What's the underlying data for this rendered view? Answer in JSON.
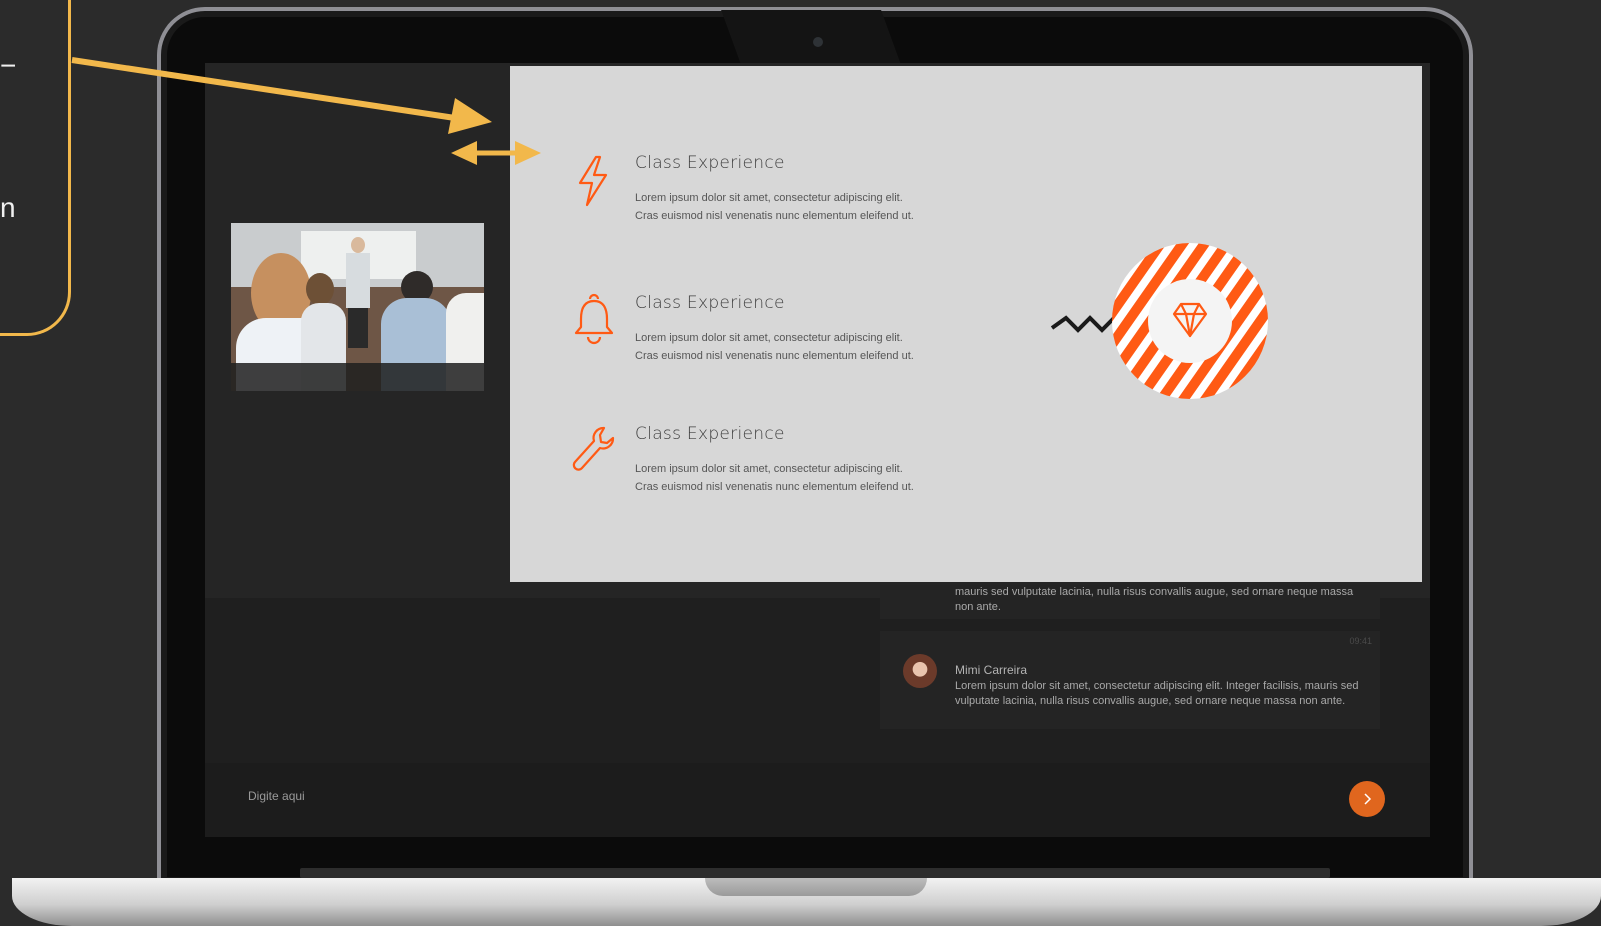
{
  "callout": {
    "glyphs": [
      "−",
      "n"
    ]
  },
  "features": [
    {
      "icon": "lightning-icon",
      "title": "Class Experience",
      "description": "Lorem ipsum dolor sit amet, consectetur adipiscing elit. Cras euismod nisl venenatis nunc elementum eleifend ut."
    },
    {
      "icon": "bell-icon",
      "title": "Class Experience",
      "description": "Lorem ipsum dolor sit amet, consectetur adipiscing elit. Cras euismod nisl venenatis nunc elementum eleifend ut."
    },
    {
      "icon": "wrench-icon",
      "title": "Class Experience",
      "description": "Lorem ipsum dolor sit amet, consectetur adipiscing elit. Cras euismod nisl venenatis nunc elementum eleifend ut."
    }
  ],
  "badge": {
    "icon": "diamond-icon"
  },
  "chat": {
    "partial_message": {
      "text": "mauris sed vulputate lacinia, nulla risus convallis augue, sed ornare neque massa non ante."
    },
    "message": {
      "author": "Mimi Carreira",
      "time": "09:41",
      "text": "Lorem ipsum dolor sit amet, consectetur adipiscing elit. Integer facilisis, mauris sed vulputate lacinia, nulla risus convallis augue, sed ornare neque massa non ante."
    }
  },
  "input": {
    "placeholder": "Digite aqui"
  },
  "colors": {
    "accent": "#ff5a14",
    "annotation": "#f2b84b",
    "send_button": "#e0661e"
  }
}
